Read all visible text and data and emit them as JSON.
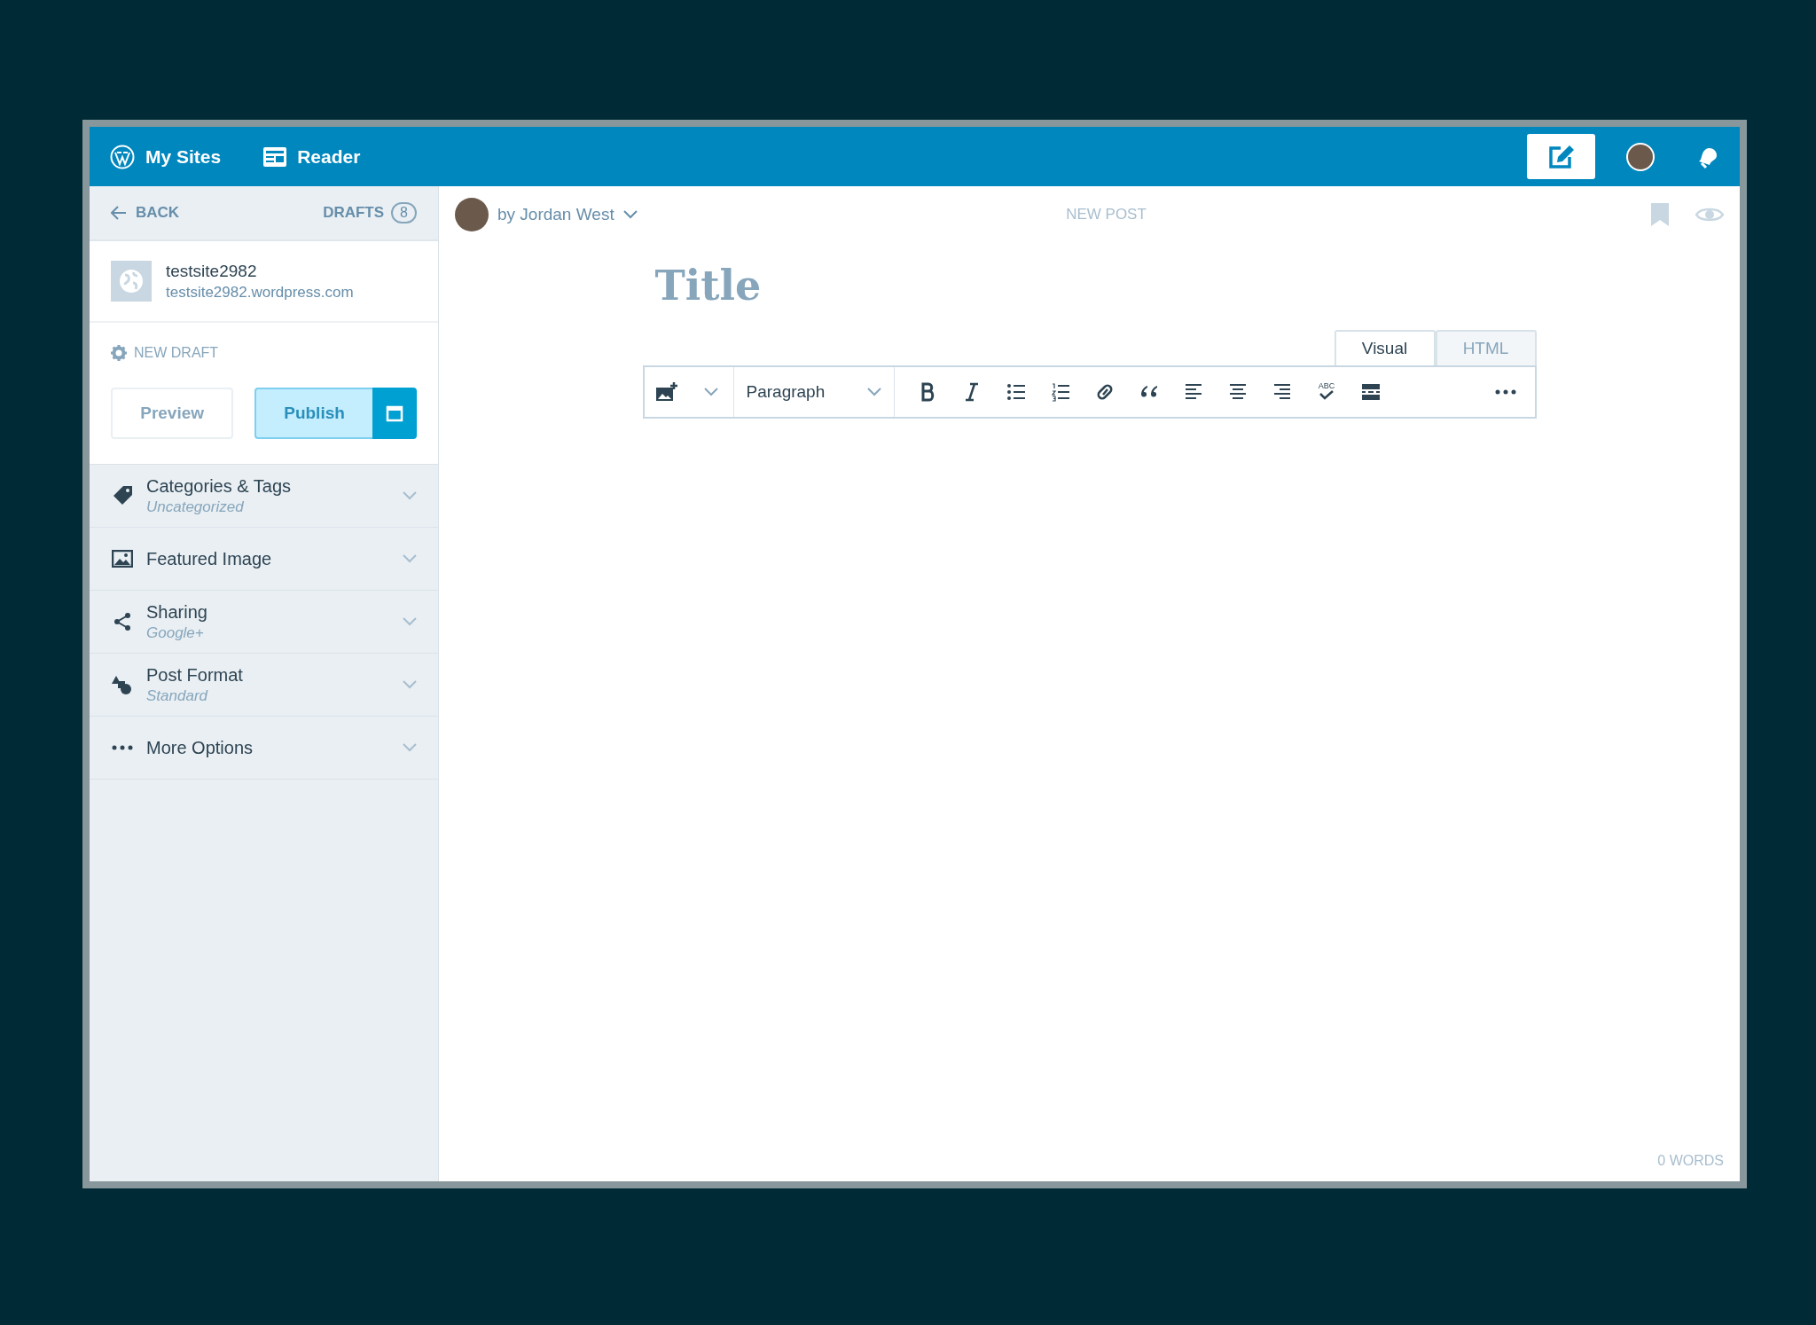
{
  "topbar": {
    "items": [
      {
        "label": "My Sites"
      },
      {
        "label": "Reader"
      }
    ],
    "write_button": {
      "selected": true
    }
  },
  "sidebar": {
    "back": "BACK",
    "drafts_label": "DRAFTS",
    "drafts_count": "8",
    "site": {
      "name": "testsite2982",
      "url": "testsite2982.wordpress.com"
    },
    "status": "NEW DRAFT",
    "preview": {
      "label": "Preview",
      "disabled": true
    },
    "publish": {
      "label": "Publish",
      "disabled": true
    },
    "sections": [
      {
        "title": "Categories & Tags",
        "subtitle": "Uncategorized"
      },
      {
        "title": "Featured Image"
      },
      {
        "title": "Sharing",
        "subtitle": "Google+"
      },
      {
        "title": "Post Format",
        "subtitle": "Standard"
      },
      {
        "title": "More Options"
      }
    ]
  },
  "editor": {
    "author": "by Jordan West",
    "status": "NEW POST",
    "title_placeholder": "Title",
    "tabs": [
      {
        "label": "Visual",
        "selected": true
      },
      {
        "label": "HTML",
        "selected": false
      }
    ],
    "format": "Paragraph",
    "spellcheck_mark": "ABC",
    "word_count": "0 WORDS"
  }
}
